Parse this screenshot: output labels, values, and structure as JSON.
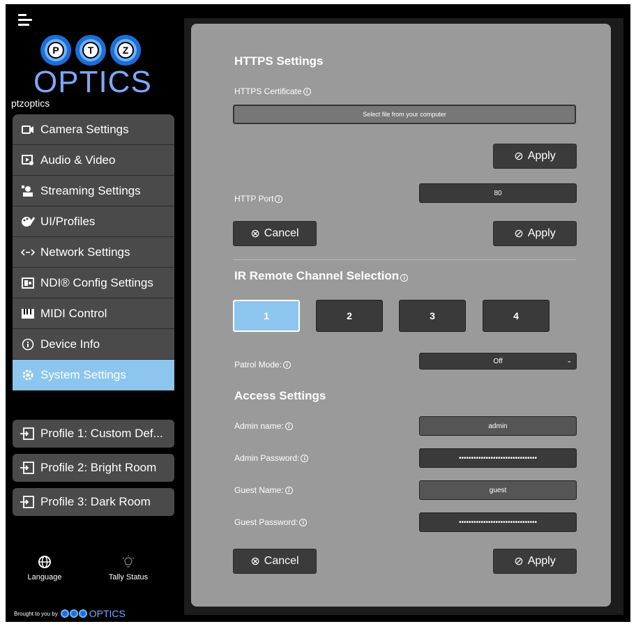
{
  "brand": {
    "logo_letters": [
      "P",
      "T",
      "Z"
    ],
    "logo_word": "OPTICS",
    "name": "ptzoptics",
    "accent_blue": "#7ea7ff",
    "active_color": "#8cc5ed"
  },
  "sidebar": {
    "items": [
      {
        "label": "Camera Settings",
        "icon": "camera-icon"
      },
      {
        "label": "Audio & Video",
        "icon": "audio-video-icon"
      },
      {
        "label": "Streaming Settings",
        "icon": "streaming-icon"
      },
      {
        "label": "UI/Profiles",
        "icon": "ui-profiles-icon"
      },
      {
        "label": "Network Settings",
        "icon": "network-icon"
      },
      {
        "label": "NDI® Config Settings",
        "icon": "ndi-icon"
      },
      {
        "label": "MIDI Control",
        "icon": "midi-icon"
      },
      {
        "label": "Device Info",
        "icon": "info-icon"
      },
      {
        "label": "System Settings",
        "icon": "gear-icon",
        "active": true
      }
    ],
    "profiles": [
      {
        "label": "Profile 1: Custom Def..."
      },
      {
        "label": "Profile 2: Bright Room"
      },
      {
        "label": "Profile 3: Dark Room"
      }
    ],
    "language_label": "Language",
    "tally_label": "Tally Status",
    "powered_by": "Brought to you by",
    "powered_word": "OPTICS"
  },
  "https": {
    "title": "HTTPS Settings",
    "cert_label": "HTTPS Certificate",
    "file_placeholder": "Select file from your computer",
    "apply_label": "Apply",
    "http_port_label": "HTTP Port",
    "http_port_value": "80",
    "cancel_label": "Cancel",
    "apply2_label": "Apply"
  },
  "ir": {
    "title": "IR Remote Channel Selection",
    "channels": [
      "1",
      "2",
      "3",
      "4"
    ],
    "active_channel": "1",
    "patrol_label": "Patrol Mode:",
    "patrol_value": "Off"
  },
  "access": {
    "title": "Access Settings",
    "admin_name_label": "Admin name:",
    "admin_name_value": "admin",
    "admin_password_label": "Admin Password:",
    "admin_password_value": "••••••••••••••••••••••••••••••••",
    "guest_name_label": "Guest Name:",
    "guest_name_value": "guest",
    "guest_password_label": "Guest Password:",
    "guest_password_value": "••••••••••••••••••••••••••••••••",
    "cancel_label": "Cancel",
    "apply_label": "Apply"
  }
}
